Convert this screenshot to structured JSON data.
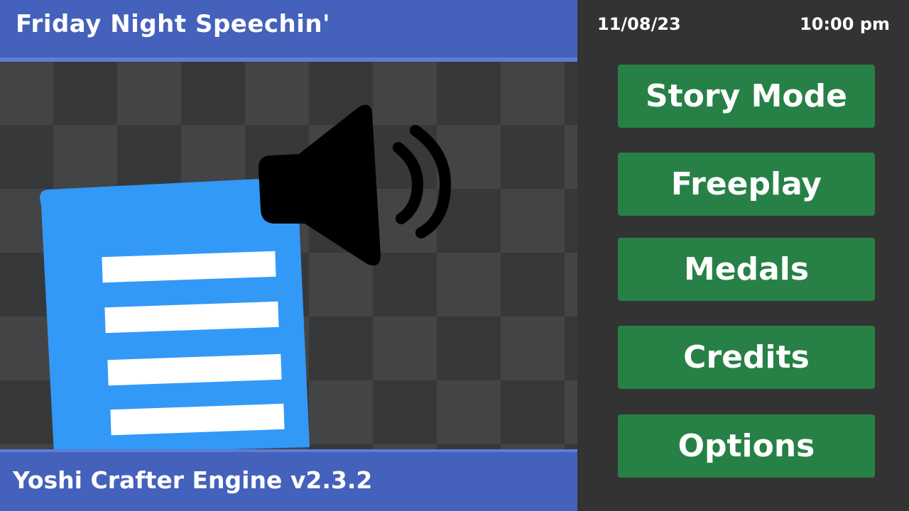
{
  "header": {
    "title": "Friday Night Speechin'"
  },
  "footer": {
    "engine_version": "Yoshi Crafter Engine v2.3.2"
  },
  "status": {
    "date": "11/08/23",
    "time": "10:00 pm"
  },
  "logo": {
    "icons": [
      "document-icon",
      "speaker-icon",
      "sound-waves-icon"
    ]
  },
  "menu": {
    "items": [
      {
        "label": "Story Mode"
      },
      {
        "label": "Freeplay"
      },
      {
        "label": "Medals"
      },
      {
        "label": "Credits"
      },
      {
        "label": "Options"
      }
    ]
  },
  "colors": {
    "header_bar": "#4461bb",
    "header_border": "#5d7dd6",
    "button": "#278146",
    "sidebar": "#333333",
    "document": "#3399f7",
    "checker_dark": "#37383a",
    "checker_light": "#434446"
  }
}
